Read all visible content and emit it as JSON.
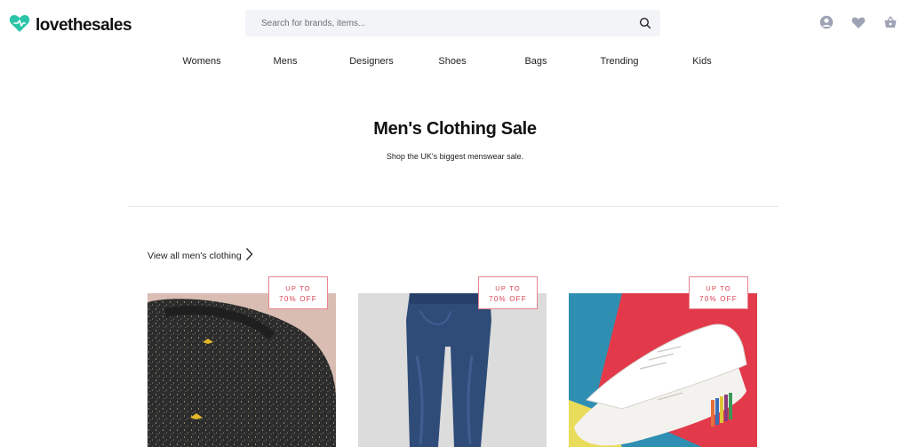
{
  "header": {
    "logo_text": "lovethesales",
    "search_placeholder": "Search for brands, items..."
  },
  "nav": [
    "Womens",
    "Mens",
    "Designers",
    "Shoes",
    "Bags",
    "Trending",
    "Kids"
  ],
  "hero": {
    "title": "Men's Clothing Sale",
    "subtitle": "Shop the UK's biggest menswear sale."
  },
  "view_all": "View all men's clothing",
  "cards": [
    {
      "badge_line1": "UP TO",
      "badge_line2": "70% OFF",
      "image": "men's speckled knit jumper"
    },
    {
      "badge_line1": "UP TO",
      "badge_line2": "70% OFF",
      "image": "men's blue jeans"
    },
    {
      "badge_line1": "UP TO",
      "badge_line2": "70% OFF",
      "image": "white leather trainers"
    }
  ],
  "colors": {
    "brand": "#2bc4a9",
    "accent": "#d9414f",
    "icon_gray": "#9ea3b5"
  }
}
